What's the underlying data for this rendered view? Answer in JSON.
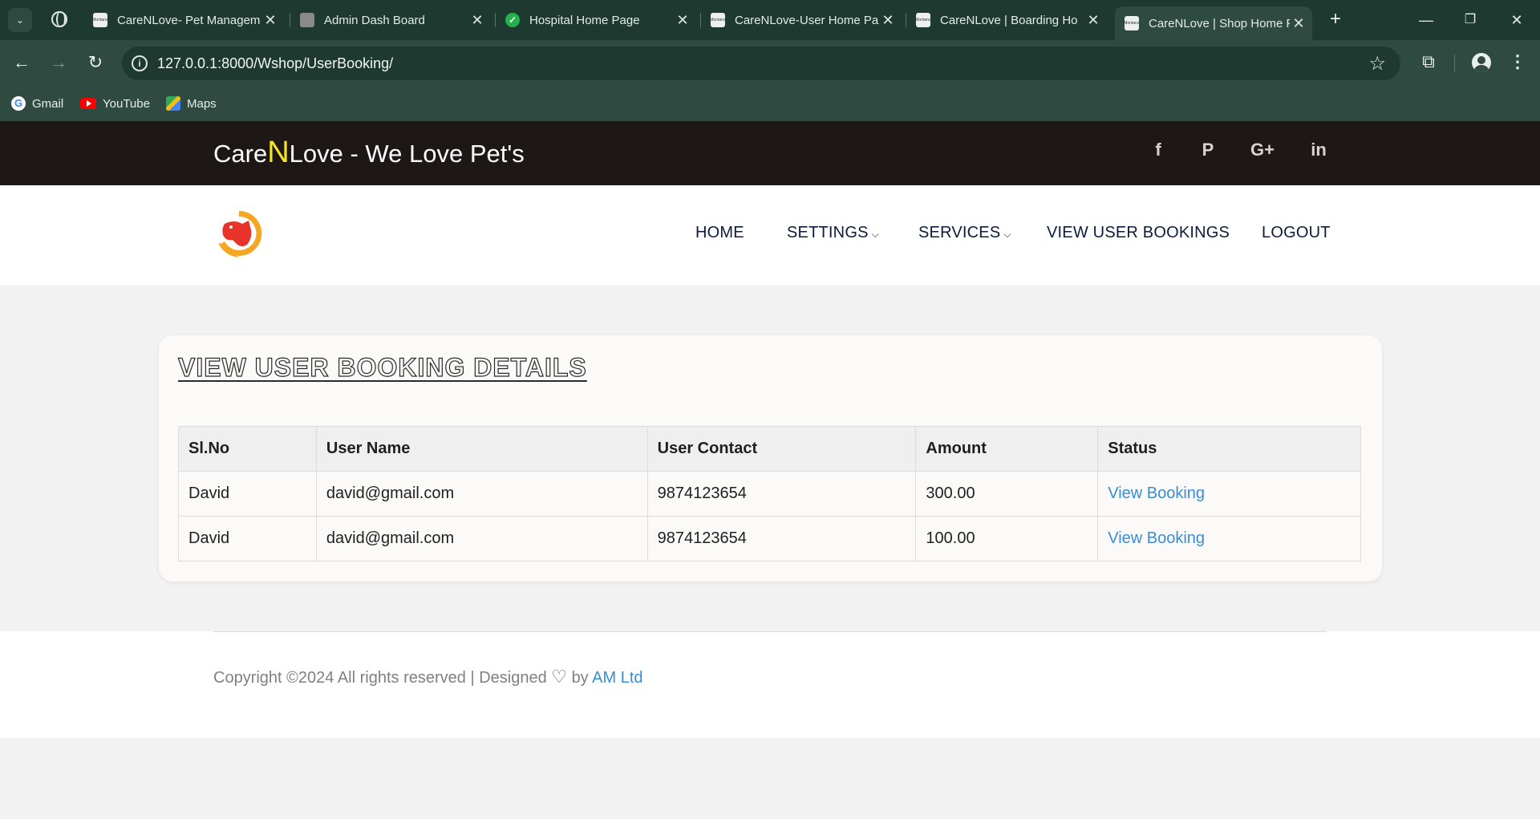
{
  "browser": {
    "tabs": [
      {
        "title": "CareNLove- Pet Managem"
      },
      {
        "title": "Admin Dash Board"
      },
      {
        "title": "Hospital Home Page"
      },
      {
        "title": "CareNLove-User Home Pa"
      },
      {
        "title": "CareNLove | Boarding Ho"
      },
      {
        "title": "CareNLove | Shop Home P"
      }
    ],
    "favicon_label": "Montana",
    "close_glyph": "✕",
    "new_tab_glyph": "+",
    "url": "127.0.0.1:8000/Wshop/UserBooking/",
    "bookmarks": [
      {
        "label": "Gmail",
        "icon": "google-icon"
      },
      {
        "label": "YouTube",
        "icon": "youtube-icon"
      },
      {
        "label": "Maps",
        "icon": "maps-icon"
      }
    ],
    "theme_color": "#2f4b41"
  },
  "site": {
    "brand_prefix": "Care",
    "brand_n": "N",
    "brand_suffix": "Love - We Love Pet's",
    "social": [
      {
        "icon": "facebook-icon",
        "glyph": "f"
      },
      {
        "icon": "pinterest-icon",
        "glyph": "P"
      },
      {
        "icon": "google-plus-icon",
        "glyph": "G+"
      },
      {
        "icon": "linkedin-icon",
        "glyph": "in"
      }
    ],
    "menu": {
      "home": "HOME",
      "settings": "SETTINGS",
      "services": "SERVICES",
      "view_user_bookings": "VIEW USER BOOKINGS",
      "logout": "LOGOUT",
      "chevron": "⌵"
    },
    "accent_color": "#f5e625",
    "link_color": "#3a8cd6"
  },
  "main": {
    "title": "VIEW USER BOOKING DETAILS",
    "table": {
      "headers": [
        "Sl.No",
        "User Name",
        "User Contact",
        "Amount",
        "Status"
      ],
      "rows": [
        [
          "David",
          "david@gmail.com",
          "9874123654",
          "300.00",
          "View Booking"
        ],
        [
          "David",
          "david@gmail.com",
          "9874123654",
          "100.00",
          "View Booking"
        ]
      ]
    }
  },
  "footer": {
    "copyright_text": "Copyright ©2024 All rights reserved | Designed",
    "heart": "♡",
    "by": "by",
    "company": "AM Ltd"
  }
}
